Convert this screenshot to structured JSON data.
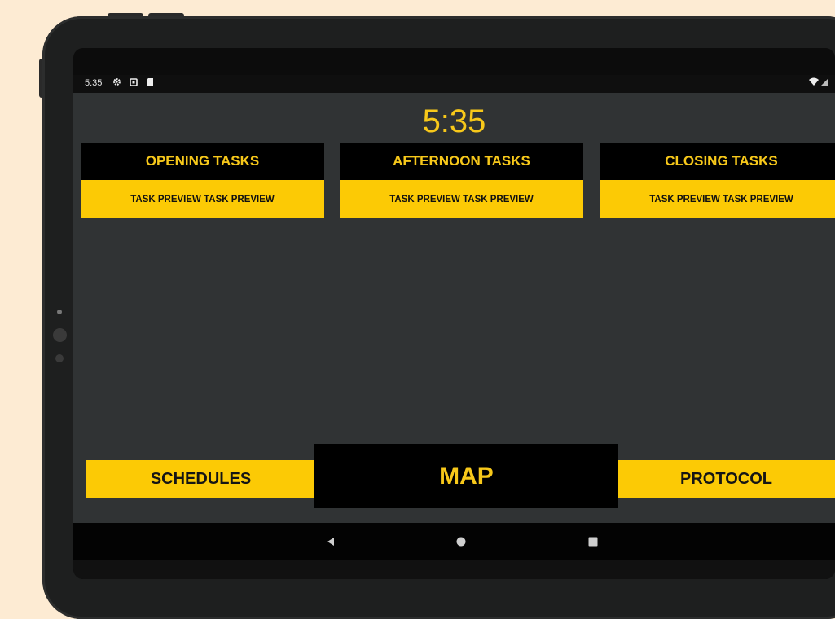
{
  "status_bar": {
    "time": "5:35",
    "icons": [
      "gear-icon",
      "square-notification-icon",
      "sd-card-icon"
    ],
    "right_icons": [
      "wifi-icon",
      "signal-icon"
    ]
  },
  "clock": {
    "time": "5:35"
  },
  "task_columns": [
    {
      "title": "OPENING TASKS",
      "preview": "TASK PREVIEW TASK PREVIEW"
    },
    {
      "title": "AFTERNOON TASKS",
      "preview": "TASK PREVIEW TASK PREVIEW"
    },
    {
      "title": "CLOSING TASKS",
      "preview": "TASK PREVIEW TASK PREVIEW"
    }
  ],
  "bottom_nav": {
    "schedules_label": "SCHEDULES",
    "map_label": "MAP",
    "protocol_label": "PROTOCOL"
  },
  "system_nav": [
    "back-icon",
    "home-icon",
    "recents-icon"
  ],
  "colors": {
    "accent_yellow": "#fcca05",
    "clock_yellow": "#f7c81a",
    "app_background": "#303334",
    "header_black": "#000000"
  }
}
